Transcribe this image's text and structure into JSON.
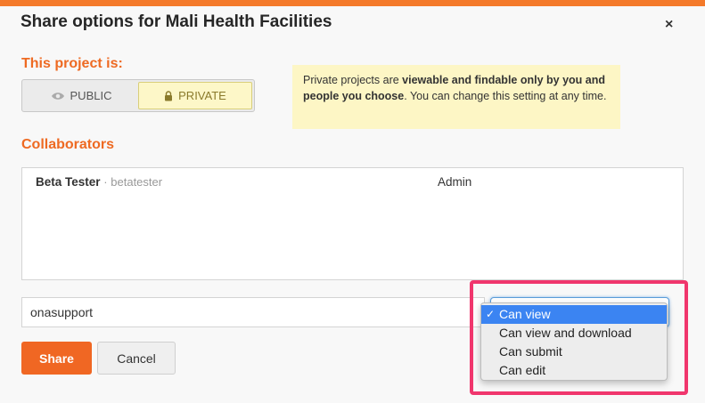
{
  "colors": {
    "accent": "#f06723",
    "heading": "#ee6a22",
    "highlight": "#f0366d",
    "selection": "#3b84f2"
  },
  "modal": {
    "title": "Share options for Mali Health Facilities",
    "close_label": "×"
  },
  "privacy": {
    "heading": "This project is:",
    "public_label": "PUBLIC",
    "private_label": "PRIVATE",
    "selected": "PRIVATE",
    "hint_pre": "Private projects are ",
    "hint_bold": "viewable and findable only by you and people you choose",
    "hint_post": ". You can change this setting at any time."
  },
  "collaborators": {
    "heading": "Collaborators",
    "rows": [
      {
        "name": "Beta Tester",
        "separator": "·",
        "username": "betatester",
        "role": "Admin"
      }
    ]
  },
  "share_form": {
    "username_value": "onasupport",
    "permission_options": [
      "Can view",
      "Can view and download",
      "Can submit",
      "Can edit"
    ],
    "selected_option": "Can view",
    "share_label": "Share",
    "cancel_label": "Cancel"
  }
}
